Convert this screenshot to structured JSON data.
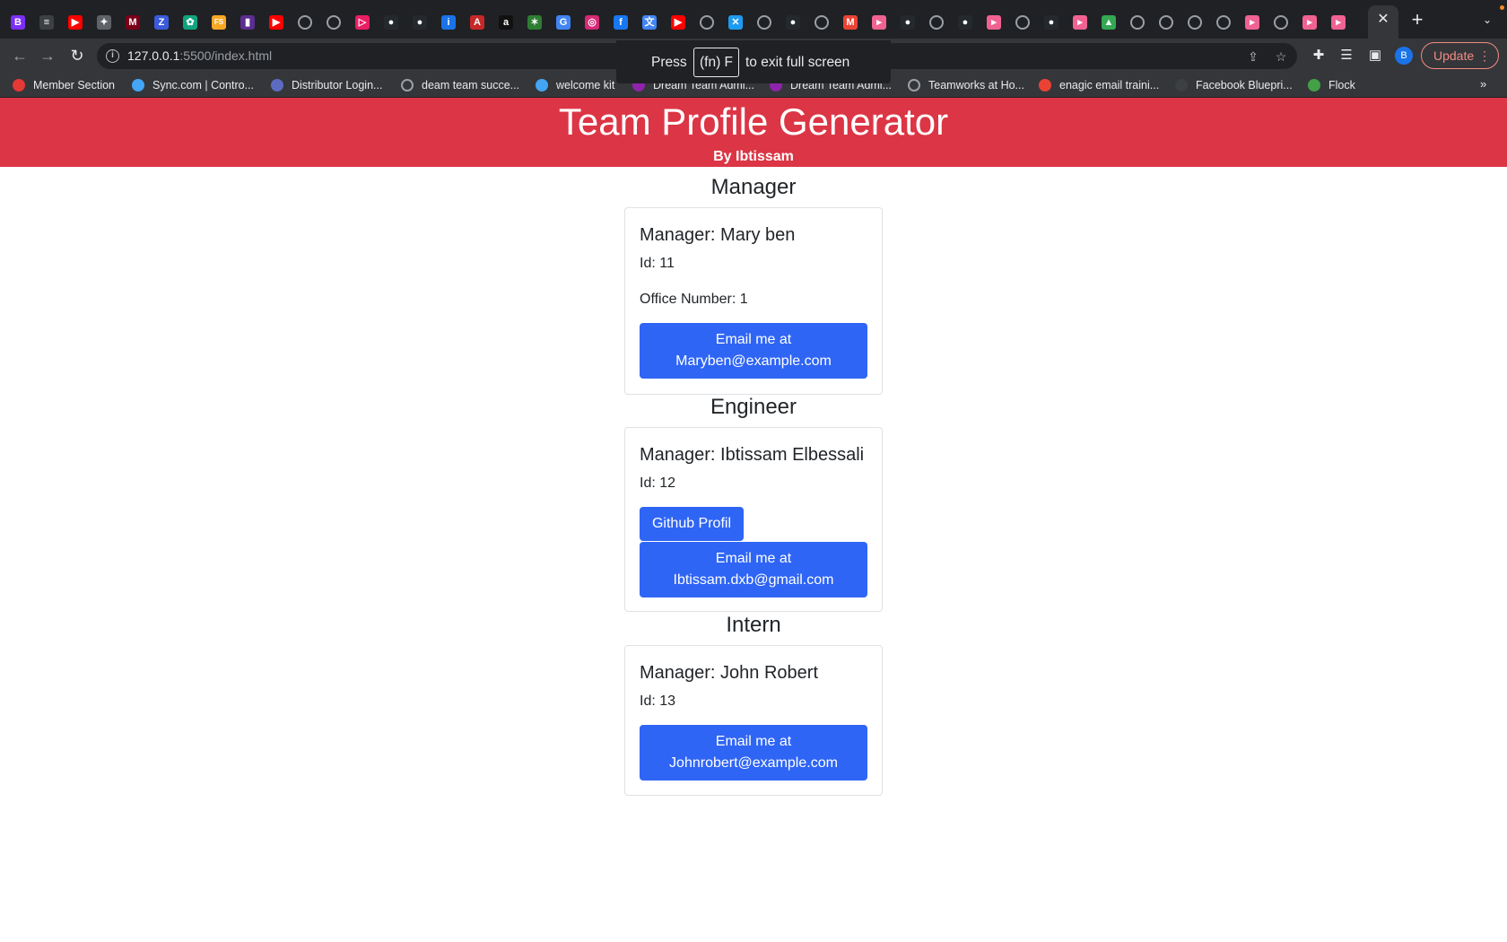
{
  "browser": {
    "url_host": "127.0.0.1",
    "url_rest": ":5500/index.html",
    "update_label": "Update",
    "profile_initial": "B",
    "tab_favicons": [
      {
        "icon": "B",
        "color": "#7b2ff7"
      },
      {
        "icon": "≡",
        "color": "#3c4043"
      },
      {
        "icon": "▶",
        "color": "#ff0000"
      },
      {
        "icon": "✦",
        "color": "#5f6368"
      },
      {
        "icon": "M",
        "color": "#7a0019"
      },
      {
        "icon": "Z",
        "color": "#3b5bdb"
      },
      {
        "icon": "✿",
        "color": "#10a37f"
      },
      {
        "icon": "FS",
        "color": "#f9a825"
      },
      {
        "icon": "▮",
        "color": "#5c2d91"
      },
      {
        "icon": "▶",
        "color": "#ff0000"
      },
      {
        "icon": "globe",
        "color": ""
      },
      {
        "icon": "globe",
        "color": ""
      },
      {
        "icon": "▷",
        "color": "#e91e63"
      },
      {
        "icon": "●",
        "color": "#24292e"
      },
      {
        "icon": "●",
        "color": "#24292e"
      },
      {
        "icon": "i",
        "color": "#1a73e8"
      },
      {
        "icon": "A",
        "color": "#c62828"
      },
      {
        "icon": "a",
        "color": "#111111"
      },
      {
        "icon": "✶",
        "color": "#2e7d32"
      },
      {
        "icon": "G",
        "color": "#4285f4"
      },
      {
        "icon": "◎",
        "color": "#d62976"
      },
      {
        "icon": "f",
        "color": "#1877f2"
      },
      {
        "icon": "文",
        "color": "#4285f4"
      },
      {
        "icon": "▶",
        "color": "#ff0000"
      },
      {
        "icon": "globe",
        "color": ""
      },
      {
        "icon": "✕",
        "color": "#1d9bf0"
      },
      {
        "icon": "globe",
        "color": ""
      },
      {
        "icon": "●",
        "color": "#24292e"
      },
      {
        "icon": "globe",
        "color": ""
      },
      {
        "icon": "M",
        "color": "#ea4335"
      },
      {
        "icon": "▸",
        "color": "#f06292"
      },
      {
        "icon": "●",
        "color": "#24292e"
      },
      {
        "icon": "globe",
        "color": ""
      },
      {
        "icon": "●",
        "color": "#24292e"
      },
      {
        "icon": "▸",
        "color": "#f06292"
      },
      {
        "icon": "globe",
        "color": ""
      },
      {
        "icon": "●",
        "color": "#24292e"
      },
      {
        "icon": "▸",
        "color": "#f06292"
      },
      {
        "icon": "▲",
        "color": "#34a853"
      },
      {
        "icon": "globe",
        "color": ""
      },
      {
        "icon": "globe",
        "color": ""
      },
      {
        "icon": "globe",
        "color": ""
      },
      {
        "icon": "globe",
        "color": ""
      },
      {
        "icon": "▸",
        "color": "#f06292"
      },
      {
        "icon": "globe",
        "color": ""
      },
      {
        "icon": "▸",
        "color": "#f06292"
      },
      {
        "icon": "▸",
        "color": "#f06292"
      }
    ],
    "fullscreen_toast": {
      "before": "Press",
      "key": "(fn) F",
      "after": "to exit full screen"
    },
    "bookmarks": [
      {
        "label": "Member Section",
        "icon_color": "#e53935",
        "globe": false
      },
      {
        "label": "Sync.com | Contro...",
        "icon_color": "#42a5f5",
        "globe": false
      },
      {
        "label": "Distributor Login...",
        "icon_color": "#5c6bc0",
        "globe": false
      },
      {
        "label": "deam team succe...",
        "icon_color": "",
        "globe": true
      },
      {
        "label": "welcome kit",
        "icon_color": "#42a5f5",
        "globe": false
      },
      {
        "label": "Dream Team Admi...",
        "icon_color": "#8e24aa",
        "globe": false
      },
      {
        "label": "Dream Team Admi...",
        "icon_color": "#8e24aa",
        "globe": false
      },
      {
        "label": "Teamworks at Ho...",
        "icon_color": "",
        "globe": true
      },
      {
        "label": "enagic email traini...",
        "icon_color": "#ea4335",
        "globe": false
      },
      {
        "label": "Facebook Bluepri...",
        "icon_color": "#3c4043",
        "globe": false
      },
      {
        "label": "Flock",
        "icon_color": "#43a047",
        "globe": false
      }
    ],
    "bookmarks_more": "»"
  },
  "header": {
    "title": "Team Profile Generator",
    "subtitle": "By Ibtissam"
  },
  "sections": [
    {
      "heading": "Manager",
      "card_title": "Manager: Mary ben",
      "id_text": "Id: 11",
      "extra_text": "Office Number: 1",
      "github_label": "",
      "email_line1": "Email me at",
      "email_line2": "Maryben@example.com"
    },
    {
      "heading": "Engineer",
      "card_title": "Manager: Ibtissam Elbessali",
      "id_text": "Id: 12",
      "extra_text": "",
      "github_label": "Github Profil",
      "email_line1": "Email me at",
      "email_line2": "Ibtissam.dxb@gmail.com"
    },
    {
      "heading": "Intern",
      "card_title": "Manager: John Robert",
      "id_text": "Id: 13",
      "extra_text": "",
      "github_label": "",
      "email_line1": "Email me at",
      "email_line2": "Johnrobert@example.com"
    }
  ]
}
